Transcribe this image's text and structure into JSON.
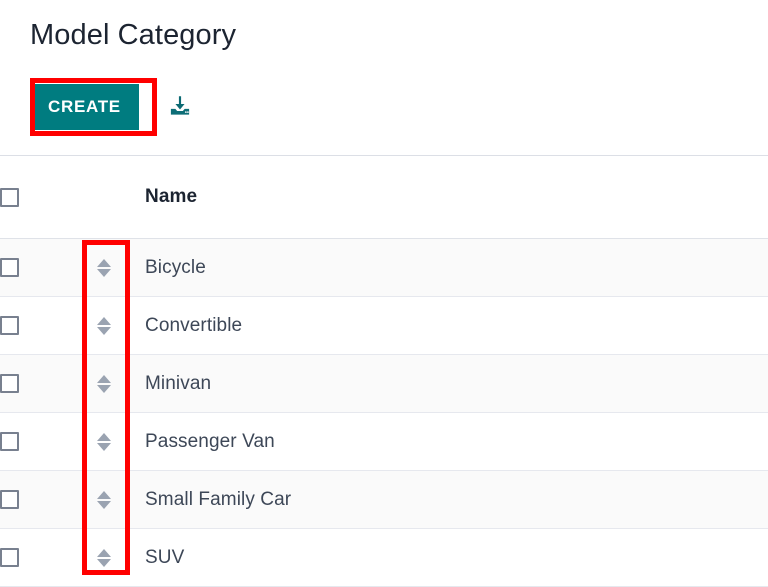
{
  "page": {
    "title": "Model Category"
  },
  "toolbar": {
    "create_label": "CREATE",
    "create_icon": "none",
    "download_icon": "download-tray-icon",
    "accent_color": "#007c80",
    "highlight_color": "#ff0000"
  },
  "table": {
    "columns": [
      {
        "key": "select",
        "label": "",
        "icon": "checkbox-icon"
      },
      {
        "key": "sort",
        "label": "",
        "icon": "sort-updown-icon"
      },
      {
        "key": "name",
        "label": "Name"
      }
    ],
    "select_all_checked": false,
    "rows": [
      {
        "name": "Bicycle",
        "checked": false,
        "sort_icon": "sort-updown-icon"
      },
      {
        "name": "Convertible",
        "checked": false,
        "sort_icon": "sort-updown-icon"
      },
      {
        "name": "Minivan",
        "checked": false,
        "sort_icon": "sort-updown-icon"
      },
      {
        "name": "Passenger Van",
        "checked": false,
        "sort_icon": "sort-updown-icon"
      },
      {
        "name": "Small Family Car",
        "checked": false,
        "sort_icon": "sort-updown-icon"
      },
      {
        "name": "SUV",
        "checked": false,
        "sort_icon": "sort-updown-icon"
      }
    ]
  },
  "annotations": [
    {
      "id": "annot-create",
      "target": "create-button",
      "color": "#ff0000"
    },
    {
      "id": "annot-sort-column",
      "target": "sort-handle-column",
      "color": "#ff0000"
    }
  ]
}
